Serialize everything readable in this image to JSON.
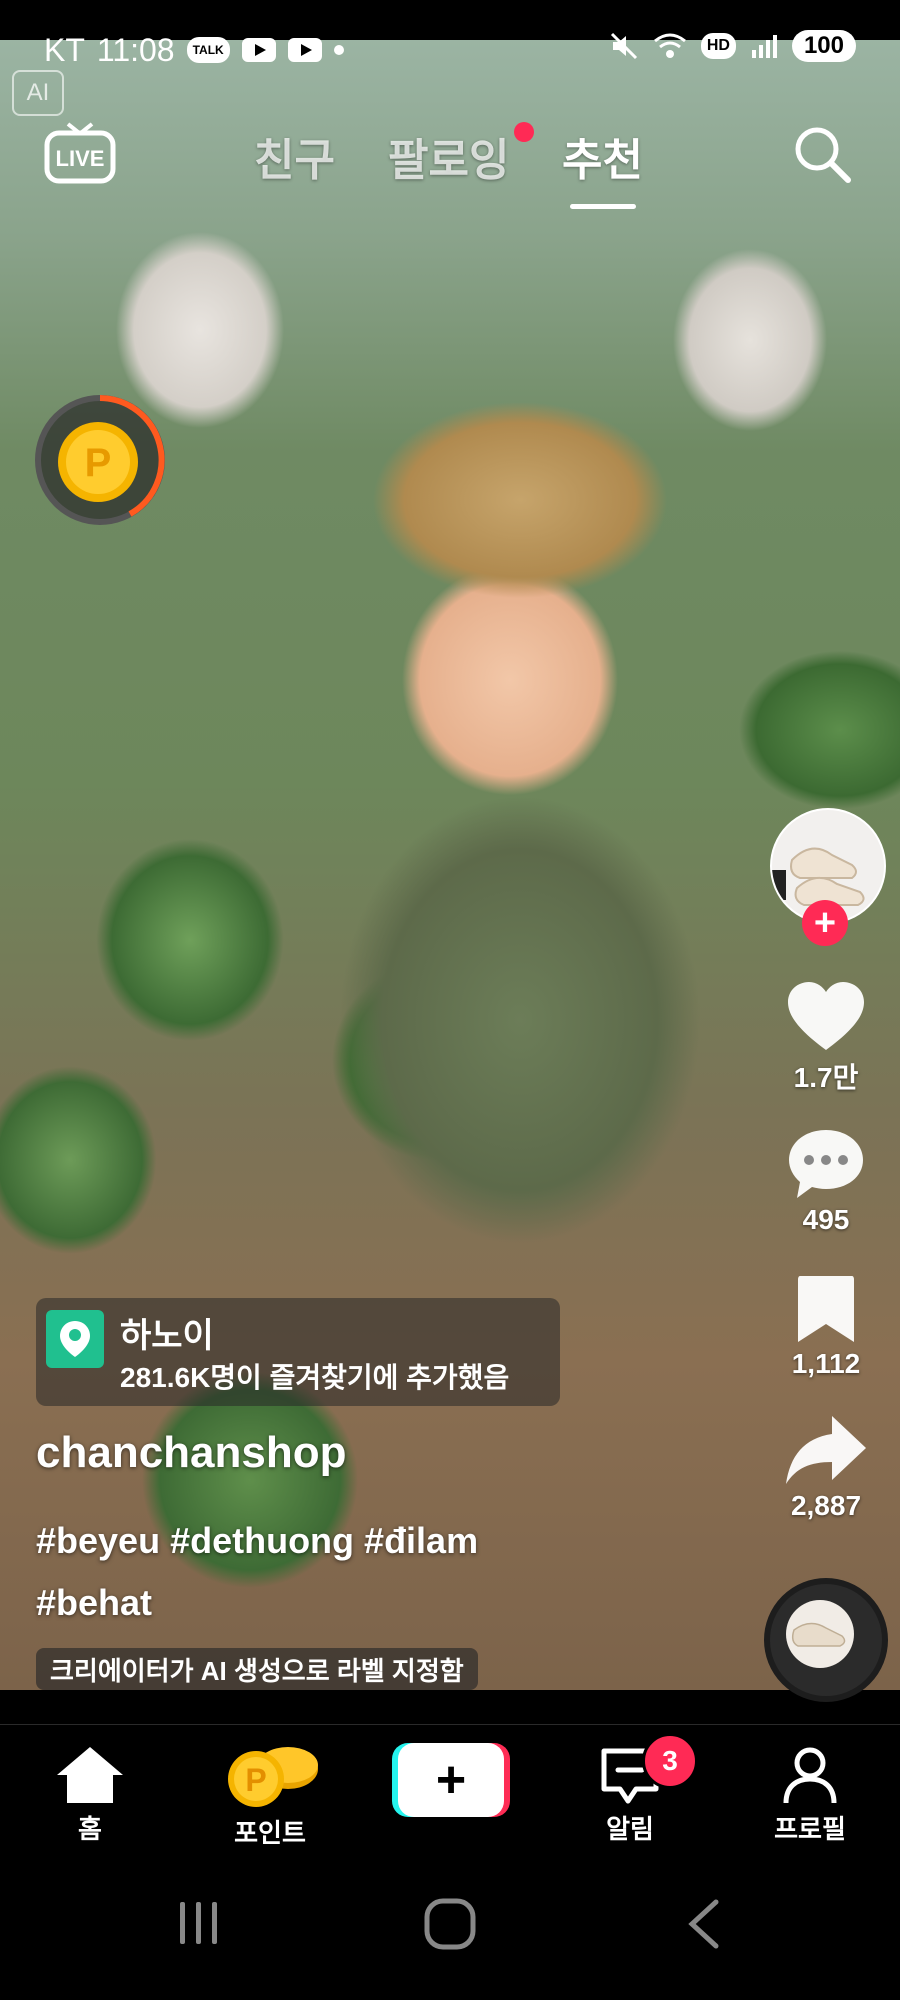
{
  "status_bar": {
    "carrier": "KT",
    "time": "11:08",
    "talk_badge": "TALK",
    "network_badge": "HD",
    "battery": "100"
  },
  "watermark": "AI",
  "top_nav": {
    "live_label": "LIVE",
    "tabs": [
      {
        "label": "친구",
        "active": false
      },
      {
        "label": "팔로잉",
        "active": false,
        "has_dot": true
      },
      {
        "label": "추천",
        "active": true
      }
    ]
  },
  "right_rail": {
    "like_count": "1.7만",
    "comment_count": "495",
    "bookmark_count": "1,112",
    "share_count": "2,887",
    "follow_symbol": "+"
  },
  "video_info": {
    "location_title": "하노이",
    "location_subtitle": "281.6K명이 즐겨찾기에 추가했음",
    "username": "chanchanshop",
    "caption_line1": "#beyeu #dethuong #đilam",
    "caption_line2": "#behat",
    "ai_label": "크리에이터가 AI 생성으로 라벨 지정함"
  },
  "bottom_nav": {
    "home": "홈",
    "points": "포인트",
    "create_symbol": "+",
    "inbox": "알림",
    "inbox_badge": "3",
    "profile": "프로필"
  },
  "colors": {
    "accent": "#ff2a55",
    "location_green": "#20c08f",
    "coin": "#f5b400"
  }
}
